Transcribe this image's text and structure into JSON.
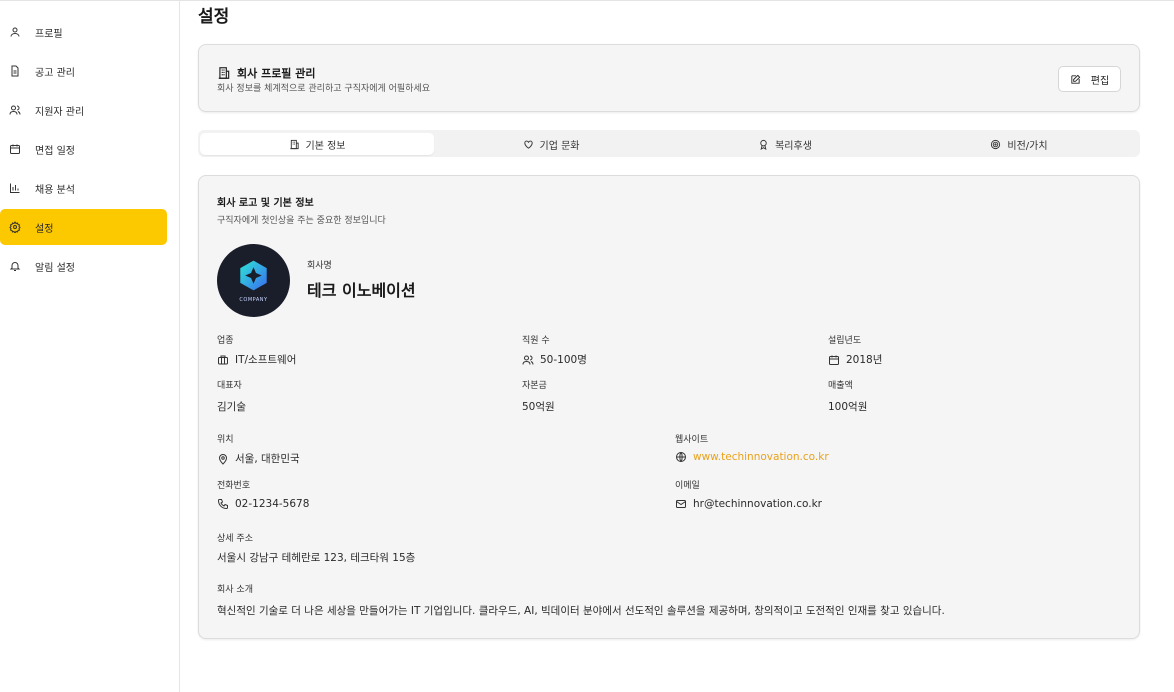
{
  "sidebar": {
    "items": [
      {
        "label": "프로필",
        "icon": "user-icon"
      },
      {
        "label": "공고 관리",
        "icon": "document-icon"
      },
      {
        "label": "지원자 관리",
        "icon": "users-icon"
      },
      {
        "label": "면접 일정",
        "icon": "calendar-icon"
      },
      {
        "label": "채용 분석",
        "icon": "bar-chart-icon"
      },
      {
        "label": "설정",
        "icon": "gear-icon",
        "active": true
      },
      {
        "label": "알림 설정",
        "icon": "bell-icon"
      }
    ],
    "accent_color": "#fcc800"
  },
  "header": {
    "title": "설정"
  },
  "profile_card": {
    "title": "회사 프로필 관리",
    "subtitle": "회사 정보를 체계적으로 관리하고 구직자에게 어필하세요",
    "edit_label": "편집"
  },
  "tabs": [
    {
      "label": "기본 정보",
      "icon": "building-icon",
      "active": true
    },
    {
      "label": "기업 문화",
      "icon": "heart-icon"
    },
    {
      "label": "복리후생",
      "icon": "award-icon"
    },
    {
      "label": "비전/가치",
      "icon": "target-icon"
    }
  ],
  "info": {
    "title": "회사 로고 및 기본 정보",
    "subtitle": "구직자에게 첫인상을 주는 중요한 정보입니다",
    "logo_text": "COMPANY",
    "company_name_label": "회사명",
    "company_name": "테크 이노베이션",
    "industry_label": "업종",
    "industry": "IT/소프트웨어",
    "employees_label": "직원 수",
    "employees": "50-100명",
    "founded_label": "설립년도",
    "founded": "2018년",
    "ceo_label": "대표자",
    "ceo": "김기술",
    "capital_label": "자본금",
    "capital": "50억원",
    "revenue_label": "매출액",
    "revenue": "100억원",
    "location_label": "위치",
    "location": "서울, 대한민국",
    "website_label": "웹사이트",
    "website": "www.techinnovation.co.kr",
    "phone_label": "전화번호",
    "phone": "02-1234-5678",
    "email_label": "이메일",
    "email": "hr@techinnovation.co.kr",
    "address_label": "상세 주소",
    "address": "서울시 강남구 테헤란로 123, 테크타워 15층",
    "intro_label": "회사 소개",
    "intro": "혁신적인 기술로 더 나은 세상을 만들어가는 IT 기업입니다. 클라우드, AI, 빅데이터 분야에서 선도적인 솔루션을 제공하며, 창의적이고 도전적인 인재를 찾고 있습니다.",
    "link_color": "#e9a21b"
  }
}
